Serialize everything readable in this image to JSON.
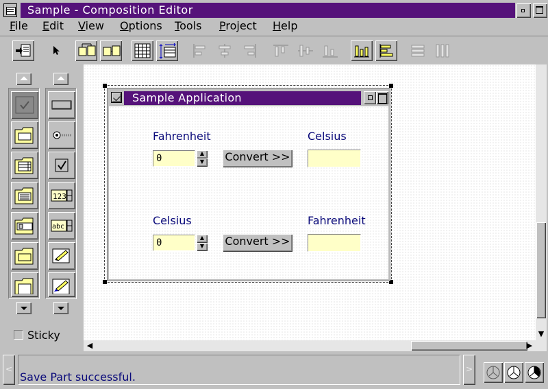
{
  "window": {
    "title": "Sample - Composition Editor"
  },
  "menu": [
    {
      "label": "File",
      "ul": "F",
      "rest": "ile"
    },
    {
      "label": "Edit",
      "ul": "E",
      "rest": "dit"
    },
    {
      "label": "View",
      "ul": "V",
      "rest": "iew"
    },
    {
      "label": "Options",
      "ul": "O",
      "rest": "ptions"
    },
    {
      "label": "Tools",
      "ul": "T",
      "rest": "ools"
    },
    {
      "label": "Project",
      "ul": "P",
      "rest": "roject"
    },
    {
      "label": "Help",
      "ul": "H",
      "rest": "elp"
    }
  ],
  "toolbar": {
    "icons": [
      "save-part-icon",
      "selection-tool-icon",
      "connection-icon",
      "browse-connections-icon",
      "grid-icon",
      "snap-to-grid-icon",
      "align-left-icon",
      "align-center-icon",
      "align-right-icon",
      "align-top-icon",
      "align-middle-icon",
      "align-bottom-icon",
      "match-width-icon",
      "match-height-icon",
      "distribute-horizontally-icon",
      "distribute-vertically-icon"
    ]
  },
  "palette": {
    "categories": [
      "selected-category-icon",
      "frame-window-icon",
      "list-parts-icon",
      "notebook-icon",
      "combo-parts-icon",
      "canvas-icon",
      "other-parts-icon"
    ],
    "parts": [
      "push-button-icon",
      "radio-button-icon",
      "check-box-icon",
      "numeric-spin-button-icon",
      "text-spin-button-icon",
      "entry-field-icon",
      "multiline-edit-icon"
    ],
    "numeric_glyph": "123",
    "text_glyph": "abc",
    "sticky_label": "Sticky"
  },
  "sample_window": {
    "title": "Sample Application",
    "row1": {
      "from_label": "Fahrenheit",
      "to_label": "Celsius",
      "value": "0",
      "button": "Convert >>"
    },
    "row2": {
      "from_label": "Celsius",
      "to_label": "Fahrenheit",
      "value": "0",
      "button": "Convert >>"
    }
  },
  "status": {
    "message": "Save Part successful."
  },
  "colors": {
    "titlebar": "#55127a",
    "label": "#0a0a7a",
    "entry": "#ffffc8",
    "face": "#c0c0c0"
  }
}
